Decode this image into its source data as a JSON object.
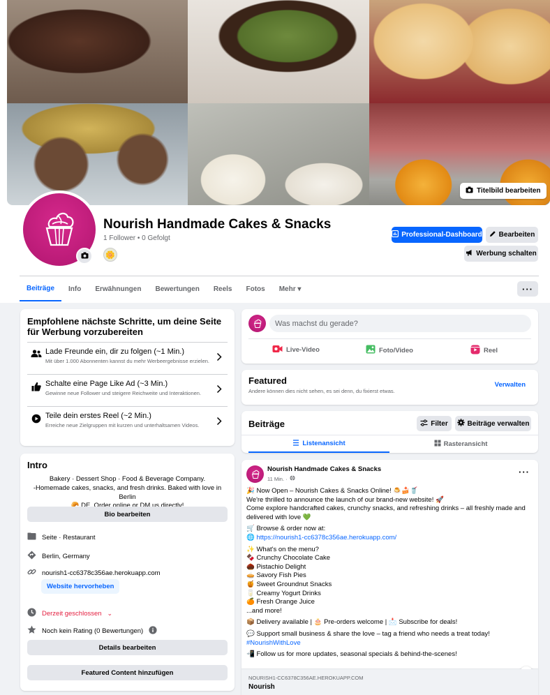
{
  "cover": {
    "edit_label": "Titelbild bearbeiten"
  },
  "profile": {
    "name": "Nourish Handmade Cakes & Snacks",
    "stats": "1 Follower • 0 Gefolgt",
    "mini_avatar": "🌼"
  },
  "actions": {
    "dashboard": "Professional-Dashboard",
    "edit": "Bearbeiten",
    "ads": "Werbung schalten"
  },
  "tabs": [
    {
      "label": "Beiträge",
      "active": true
    },
    {
      "label": "Info"
    },
    {
      "label": "Erwähnungen"
    },
    {
      "label": "Bewertungen"
    },
    {
      "label": "Reels"
    },
    {
      "label": "Fotos"
    },
    {
      "label": "Mehr ▾"
    }
  ],
  "more_dots": "···",
  "steps": {
    "title": "Empfohlene nächste Schritte, um deine Seite für Werbung vorzubereiten",
    "items": [
      {
        "title": "Lade Freunde ein, dir zu folgen (~1 Min.)",
        "sub": "Mit über 1.000 Abonnenten kannst du mehr Werbeergebnisse erzielen.",
        "icon": "people-icon"
      },
      {
        "title": "Schalte eine Page Like Ad (~3 Min.)",
        "sub": "Gewinne neue Follower und steigere Reichweite und Interaktionen.",
        "icon": "thumbs-up-icon"
      },
      {
        "title": "Teile dein erstes Reel (~2 Min.)",
        "sub": "Erreiche neue Zielgruppen mit kurzen und unterhaltsamen Videos.",
        "icon": "reel-icon"
      }
    ],
    "chevron": "›"
  },
  "intro": {
    "title": "Intro",
    "bio_line1": "Bakery · Dessert Shop · Food & Beverage Company.",
    "bio_line2": "-Homemade cakes, snacks, and fresh drinks. Baked with love in Berlin",
    "bio_line3": "🥐 DE. Order online or DM us directly!",
    "bio_btn": "Bio bearbeiten",
    "category": "Seite · Restaurant",
    "location": "Berlin, Germany",
    "website": "nourish1-cc6378c356ae.herokuapp.com",
    "website_btn": "Website hervorheben",
    "status": "Derzeit geschlossen",
    "status_chev": "⌄",
    "rating": "Noch kein Rating (0 Bewertungen)",
    "details_btn": "Details bearbeiten",
    "featured_btn": "Featured Content hinzufügen",
    "status_color": "#e41e3f"
  },
  "composer": {
    "placeholder": "Was machst du gerade?",
    "live": "Live-Video",
    "photo": "Foto/Video",
    "reel": "Reel"
  },
  "featured": {
    "title": "Featured",
    "sub": "Andere können dies nicht sehen, es sei denn, du fixierst etwas.",
    "manage": "Verwalten"
  },
  "posts_header": {
    "title": "Beiträge",
    "filter": "Filter",
    "manage": "Beiträge verwalten",
    "list_view": "Listenansicht",
    "grid_view": "Rasteransicht"
  },
  "post": {
    "author": "Nourish Handmade Cakes & Snacks",
    "time": "11 Min. ·",
    "menu": "···",
    "lines": [
      "🎉 Now Open – Nourish Cakes & Snacks Online! 🍮🍰🥤",
      "We're thrilled to announce the launch of our brand-new website! 🚀",
      "Come explore handcrafted cakes, crunchy snacks, and refreshing drinks – all freshly made and",
      "delivered with love 💚",
      "",
      "🛒 Browse & order now at:",
      "🌐 https://nourish1-cc6378c356ae.herokuapp.com/",
      "",
      "✨ What's on the menu?",
      "🍫 Crunchy Chocolate Cake",
      "🌰 Pistachio Delight",
      "🥧 Savory Fish Pies",
      "🍯 Sweet Groundnut Snacks",
      "🥛 Creamy Yogurt Drinks",
      "🍊 Fresh Orange Juice",
      "...and more!",
      "",
      "📦 Delivery available | 🎂 Pre-orders welcome | 📩 Subscribe for deals!",
      "💬 Support small business & share the love – tag a friend who needs a treat today!",
      "#NourishWithLove",
      "",
      "📲 Follow us for more updates, seasonal specials & behind-the-scenes!"
    ],
    "link_domain": "NOURISH1-CC6378C356AE.HEROKUAPP.COM",
    "link_title": "Nourish",
    "info": "i"
  },
  "colors": {
    "accent": "#0866ff",
    "brand": "#c41e7e",
    "background": "#f0f2f5"
  }
}
